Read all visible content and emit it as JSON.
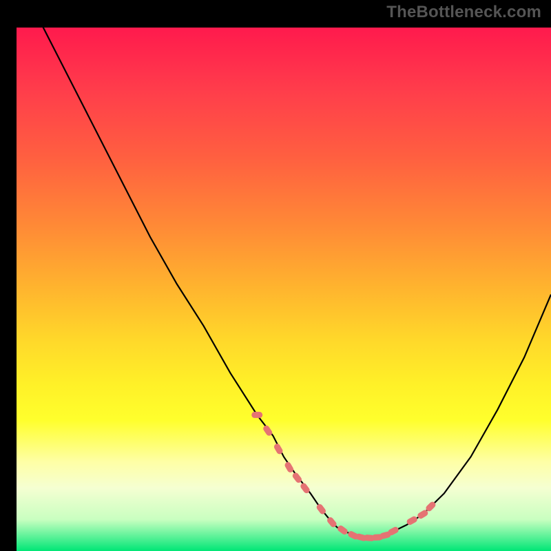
{
  "watermark": {
    "text": "TheBottleneck.com"
  },
  "colors": {
    "page_bg": "#000000",
    "line": "#000000",
    "highlight_dot": "#e57373",
    "gradient": [
      "#ff1a4d",
      "#ff3d4b",
      "#ff6040",
      "#ff8a36",
      "#ffb52e",
      "#ffd92a",
      "#fff028",
      "#ffff2c",
      "#feffa6",
      "#f5ffd2",
      "#c8ffc0",
      "#00e676"
    ]
  },
  "chart_data": {
    "type": "line",
    "title": "",
    "xlabel": "",
    "ylabel": "",
    "xlim": [
      0,
      100
    ],
    "ylim": [
      0,
      100
    ],
    "grid": false,
    "legend": false,
    "x": [
      0,
      2,
      5,
      10,
      15,
      20,
      25,
      30,
      35,
      40,
      45,
      48,
      50,
      52,
      55,
      57,
      59,
      60,
      62,
      64,
      66,
      68,
      70,
      73,
      76,
      80,
      85,
      90,
      95,
      100
    ],
    "values": [
      122,
      108,
      100,
      90,
      80,
      70,
      60,
      51,
      43,
      34,
      26,
      22,
      18,
      15,
      11,
      8,
      5.5,
      4.5,
      3.5,
      2.8,
      2.5,
      2.8,
      3.5,
      5,
      7,
      11,
      18,
      27,
      37,
      49
    ],
    "highlight_x": [
      45,
      47,
      49,
      51,
      52.5,
      54,
      57,
      59,
      61,
      63,
      64.5,
      66,
      67.5,
      69,
      70.5,
      74,
      76,
      77.5
    ],
    "highlight_values": [
      26,
      23,
      19.5,
      16,
      14,
      12,
      8,
      5.5,
      4,
      3,
      2.6,
      2.5,
      2.6,
      3,
      3.8,
      5.8,
      7,
      8.5
    ]
  }
}
